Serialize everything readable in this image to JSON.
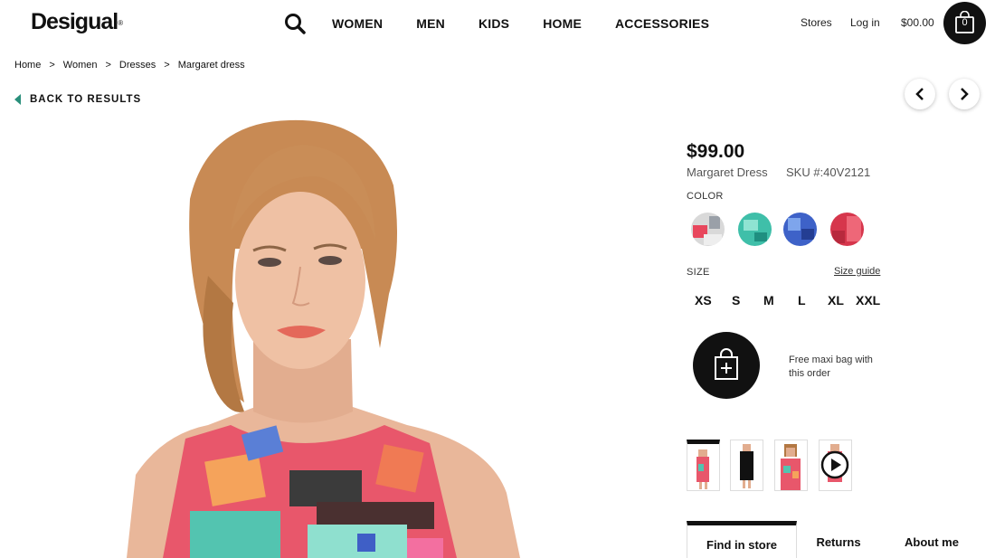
{
  "header": {
    "logo": "Desigual",
    "logo_mark": "®",
    "nav": [
      "WOMEN",
      "MEN",
      "KIDS",
      "HOME",
      "ACCESSORIES"
    ],
    "stores": "Stores",
    "login": "Log in",
    "cart_total": "$00.00",
    "cart_count": "0"
  },
  "breadcrumb": [
    "Home",
    "Women",
    "Dresses",
    "Margaret dress"
  ],
  "breadcrumb_sep": ">",
  "back_label": "BACK TO RESULTS",
  "product": {
    "price": "$99.00",
    "name": "Margaret Dress",
    "sku": "SKU #:40V2121",
    "color_label": "COLOR",
    "swatches": [
      "multicolor-grey",
      "turquoise",
      "blue",
      "red"
    ],
    "size_label": "SIZE",
    "size_guide": "Size guide",
    "sizes": [
      "XS",
      "S",
      "M",
      "L",
      "XL",
      "XXL"
    ],
    "promo": "Free maxi bag with this order"
  },
  "tabs": [
    "Find in store",
    "Returns",
    "About me"
  ],
  "colors": {
    "accent": "#2a8f7b",
    "dark": "#111111"
  }
}
